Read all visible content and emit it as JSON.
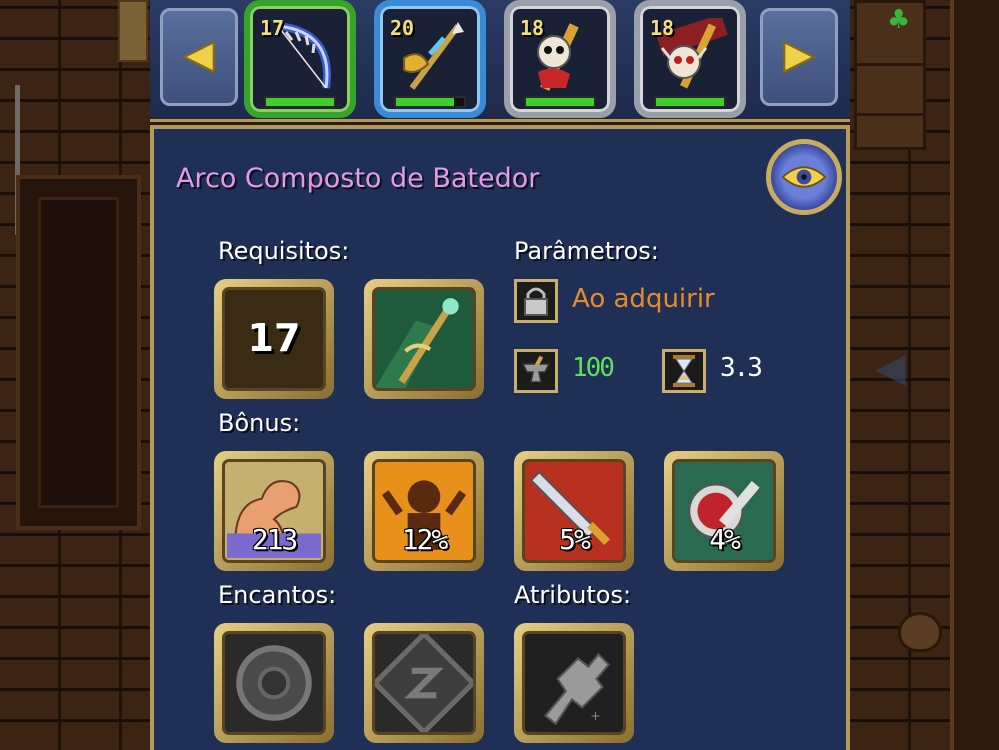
{
  "carousel": {
    "prev_icon": "arrow-left-icon",
    "next_icon": "arrow-right-icon",
    "items": [
      {
        "level": "17",
        "frame": "green",
        "icon": "bow-icon",
        "bar_fill": 1.0
      },
      {
        "level": "20",
        "frame": "blue",
        "icon": "spear-icon",
        "bar_fill": 0.85
      },
      {
        "level": "18",
        "frame": "grey",
        "icon": "skull-armor-icon",
        "bar_fill": 1.0
      },
      {
        "level": "18",
        "frame": "grey",
        "icon": "skull-helmet-icon",
        "bar_fill": 1.0
      }
    ]
  },
  "item": {
    "name": "Arco Composto de Batedor",
    "eye_icon": "eye-icon"
  },
  "requirements": {
    "label": "Requisitos:",
    "level": "17",
    "class_icon": "hunter-class-icon"
  },
  "parameters": {
    "label": "Parâmetros:",
    "bind": "Ao adquirir",
    "durability": "100",
    "speed": "3.3",
    "lock_icon": "lock-icon",
    "anvil_icon": "anvil-icon",
    "hourglass_icon": "hourglass-icon"
  },
  "bonus": {
    "label": "Bônus:",
    "items": [
      {
        "icon": "strength-icon",
        "value": "213"
      },
      {
        "icon": "rage-icon",
        "value": "12%"
      },
      {
        "icon": "sword-icon",
        "value": "5%"
      },
      {
        "icon": "potion-icon",
        "value": "4%"
      }
    ]
  },
  "enchants": {
    "label": "Encantos:",
    "slots": [
      "empty-enchant-slot-icon",
      "empty-rune-slot-icon"
    ]
  },
  "attributes": {
    "label": "Atributos:",
    "icon": "gauntlet-icon"
  },
  "colors": {
    "title": "#e59ae8",
    "acquire": "#e88a29",
    "durability": "#5fe05a",
    "panel": "#1f2f55",
    "gold_frame": "#b49b5c"
  }
}
